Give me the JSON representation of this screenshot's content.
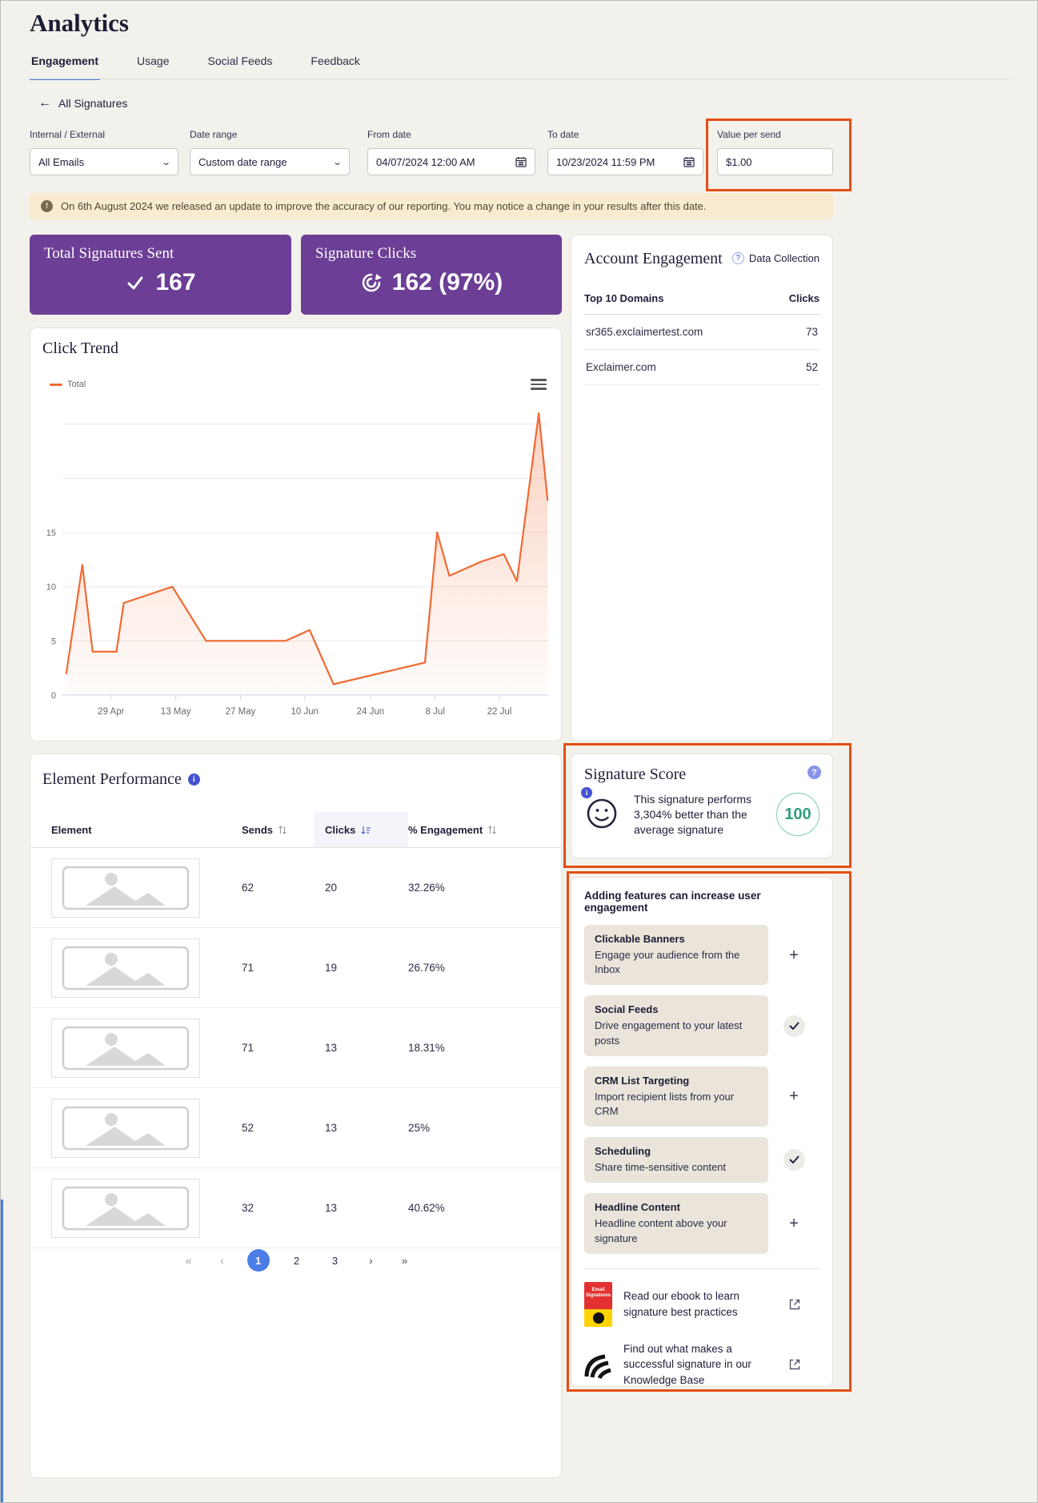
{
  "page": {
    "title": "Analytics"
  },
  "tabs": {
    "engagement": "Engagement",
    "usage": "Usage",
    "social_feeds": "Social Feeds",
    "feedback": "Feedback"
  },
  "back_link": "All Signatures",
  "filters": {
    "internal_external": {
      "label": "Internal / External",
      "value": "All Emails"
    },
    "date_range": {
      "label": "Date range",
      "value": "Custom date range"
    },
    "from_date": {
      "label": "From date",
      "value": "04/07/2024 12:00 AM"
    },
    "to_date": {
      "label": "To date",
      "value": "10/23/2024 11:59 PM"
    },
    "value_per_send": {
      "label": "Value per send",
      "value": "$1.00"
    }
  },
  "notice": "On 6th August 2024 we released an update to improve the accuracy of our reporting. You may notice a change in your results after this date.",
  "stats": {
    "total_sent": {
      "title": "Total Signatures Sent",
      "value": "167"
    },
    "signature_clicks": {
      "title": "Signature Clicks",
      "value": "162 (97%)"
    }
  },
  "account_engagement": {
    "title": "Account Engagement",
    "data_collection": "Data Collection",
    "col_domain": "Top 10 Domains",
    "col_clicks": "Clicks",
    "rows": [
      {
        "domain": "sr365.exclaimertest.com",
        "clicks": "73"
      },
      {
        "domain": "Exclaimer.com",
        "clicks": "52"
      }
    ]
  },
  "chart_data": {
    "type": "area",
    "title": "Click Trend",
    "legend": "Total",
    "color": "#f06a33",
    "xlabel": "",
    "ylabel": "",
    "grid": true,
    "legend_position": "top-left",
    "ylim": [
      0,
      27
    ],
    "grid_values": [
      0,
      5,
      10,
      15,
      20,
      25
    ],
    "y_ticks": [
      0,
      5,
      10,
      15
    ],
    "x_ticks": [
      {
        "label": "29 Apr",
        "x": 0.1
      },
      {
        "label": "13 May",
        "x": 0.233
      },
      {
        "label": "27 May",
        "x": 0.366
      },
      {
        "label": "10 Jun",
        "x": 0.498
      },
      {
        "label": "24 Jun",
        "x": 0.633
      },
      {
        "label": "8 Jul",
        "x": 0.766
      },
      {
        "label": "22 Jul",
        "x": 0.898
      }
    ],
    "points": [
      [
        0.008,
        2
      ],
      [
        0.041,
        12
      ],
      [
        0.062,
        4
      ],
      [
        0.111,
        4
      ],
      [
        0.126,
        8.5
      ],
      [
        0.226,
        10
      ],
      [
        0.295,
        5
      ],
      [
        0.459,
        5
      ],
      [
        0.508,
        6
      ],
      [
        0.557,
        1
      ],
      [
        0.745,
        3
      ],
      [
        0.77,
        15
      ],
      [
        0.795,
        11
      ],
      [
        0.86,
        12.3
      ],
      [
        0.907,
        13
      ],
      [
        0.934,
        10.5
      ],
      [
        0.979,
        26
      ],
      [
        0.997,
        18
      ]
    ]
  },
  "element_performance": {
    "title": "Element Performance",
    "columns": {
      "element": "Element",
      "sends": "Sends",
      "clicks": "Clicks",
      "engagement": "% Engagement"
    },
    "rows": [
      {
        "sends": "62",
        "clicks": "20",
        "engagement": "32.26%"
      },
      {
        "sends": "71",
        "clicks": "19",
        "engagement": "26.76%"
      },
      {
        "sends": "71",
        "clicks": "13",
        "engagement": "18.31%"
      },
      {
        "sends": "52",
        "clicks": "13",
        "engagement": "25%"
      },
      {
        "sends": "32",
        "clicks": "13",
        "engagement": "40.62%"
      }
    ],
    "pagination": {
      "first": "«",
      "prev": "‹",
      "pages": [
        "1",
        "2",
        "3"
      ],
      "current": "1",
      "next": "›",
      "last": "»"
    }
  },
  "signature_score": {
    "title": "Signature Score",
    "description": "This signature performs 3,304% better than the average signature",
    "score": "100"
  },
  "features": {
    "header": "Adding features can increase user engagement",
    "items": [
      {
        "title": "Clickable Banners",
        "description": "Engage your audience from the Inbox",
        "state": "add"
      },
      {
        "title": "Social Feeds",
        "description": "Drive engagement to your latest posts",
        "state": "added"
      },
      {
        "title": "CRM List Targeting",
        "description": "Import recipient lists from your CRM",
        "state": "add"
      },
      {
        "title": "Scheduling",
        "description": "Share time-sensitive content",
        "state": "added"
      },
      {
        "title": "Headline Content",
        "description": "Headline content above your signature",
        "state": "add"
      }
    ],
    "ebook_cover_text": "Email Signatures",
    "links": [
      {
        "text": "Read our ebook to learn signature best practices"
      },
      {
        "text": "Find out what makes a successful signature in our Knowledge Base"
      }
    ]
  },
  "colors": {
    "purple": "#6c3e95",
    "accent_blue": "#4a7de8",
    "chart_orange": "#f06a33",
    "highlight_orange": "#e44f13",
    "score_green": "#2f9e7d"
  }
}
